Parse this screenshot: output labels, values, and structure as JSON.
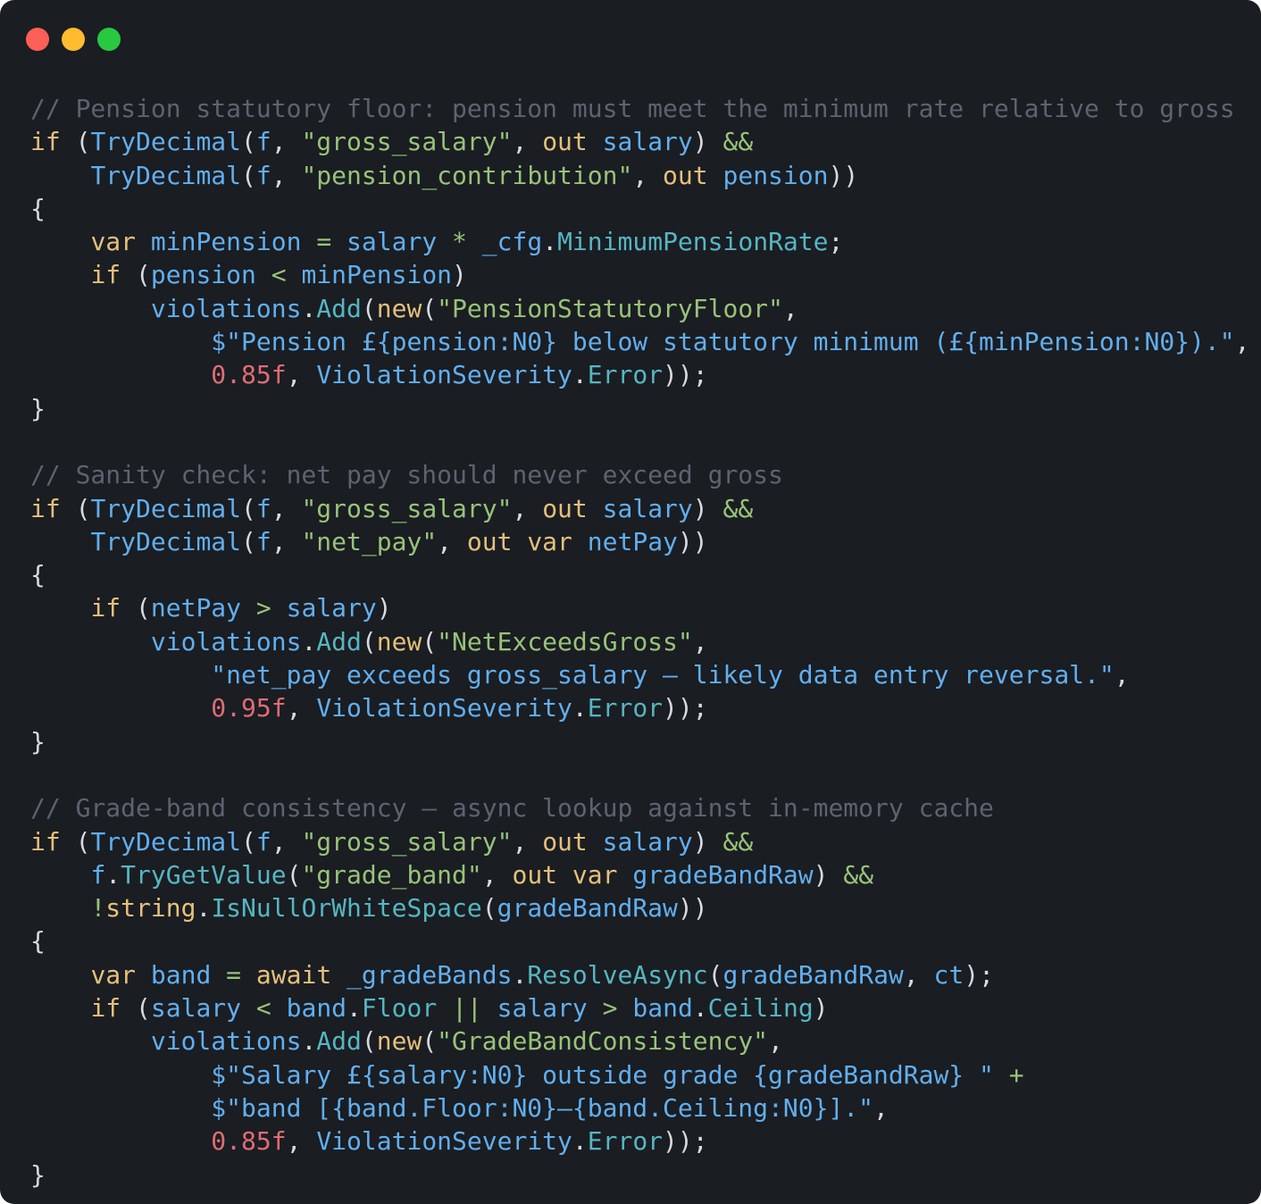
{
  "window": {
    "controls": [
      {
        "name": "close",
        "color": "#ff5f57"
      },
      {
        "name": "minimize",
        "color": "#febc2e"
      },
      {
        "name": "zoom",
        "color": "#28c840"
      }
    ]
  },
  "theme": {
    "background": "#1a1d22",
    "comment": "#5c6370",
    "keyword": "#e5c07b",
    "identifier": "#61afef",
    "property": "#56b6c2",
    "string": "#98c379",
    "number": "#e06c75",
    "operator": "#98c379",
    "punctuation": "#d7dae0"
  },
  "code": {
    "language": "csharp",
    "lines": [
      [
        {
          "t": "comment",
          "v": "// Pension statutory floor: pension must meet the minimum rate relative to gross"
        }
      ],
      [
        {
          "t": "keyword",
          "v": "if"
        },
        {
          "t": "punct",
          "v": " ("
        },
        {
          "t": "ident",
          "v": "TryDecimal"
        },
        {
          "t": "punct",
          "v": "("
        },
        {
          "t": "ident",
          "v": "f"
        },
        {
          "t": "punct",
          "v": ", "
        },
        {
          "t": "string",
          "v": "\"gross_salary\""
        },
        {
          "t": "punct",
          "v": ", "
        },
        {
          "t": "keyword",
          "v": "out"
        },
        {
          "t": "punct",
          "v": " "
        },
        {
          "t": "ident",
          "v": "salary"
        },
        {
          "t": "punct",
          "v": ") "
        },
        {
          "t": "op",
          "v": "&&"
        }
      ],
      [
        {
          "t": "punct",
          "v": "    "
        },
        {
          "t": "ident",
          "v": "TryDecimal"
        },
        {
          "t": "punct",
          "v": "("
        },
        {
          "t": "ident",
          "v": "f"
        },
        {
          "t": "punct",
          "v": ", "
        },
        {
          "t": "string",
          "v": "\"pension_contribution\""
        },
        {
          "t": "punct",
          "v": ", "
        },
        {
          "t": "keyword",
          "v": "out"
        },
        {
          "t": "punct",
          "v": " "
        },
        {
          "t": "ident",
          "v": "pension"
        },
        {
          "t": "punct",
          "v": "))"
        }
      ],
      [
        {
          "t": "punct",
          "v": "{"
        }
      ],
      [
        {
          "t": "punct",
          "v": "    "
        },
        {
          "t": "keyword",
          "v": "var"
        },
        {
          "t": "punct",
          "v": " "
        },
        {
          "t": "ident",
          "v": "minPension"
        },
        {
          "t": "punct",
          "v": " "
        },
        {
          "t": "op",
          "v": "="
        },
        {
          "t": "punct",
          "v": " "
        },
        {
          "t": "ident",
          "v": "salary"
        },
        {
          "t": "punct",
          "v": " "
        },
        {
          "t": "op",
          "v": "*"
        },
        {
          "t": "punct",
          "v": " "
        },
        {
          "t": "ident",
          "v": "_cfg"
        },
        {
          "t": "punct",
          "v": "."
        },
        {
          "t": "prop",
          "v": "MinimumPensionRate"
        },
        {
          "t": "punct",
          "v": ";"
        }
      ],
      [
        {
          "t": "punct",
          "v": "    "
        },
        {
          "t": "keyword",
          "v": "if"
        },
        {
          "t": "punct",
          "v": " ("
        },
        {
          "t": "ident",
          "v": "pension"
        },
        {
          "t": "punct",
          "v": " "
        },
        {
          "t": "op",
          "v": "<"
        },
        {
          "t": "punct",
          "v": " "
        },
        {
          "t": "ident",
          "v": "minPension"
        },
        {
          "t": "punct",
          "v": ")"
        }
      ],
      [
        {
          "t": "punct",
          "v": "        "
        },
        {
          "t": "ident",
          "v": "violations"
        },
        {
          "t": "punct",
          "v": "."
        },
        {
          "t": "prop",
          "v": "Add"
        },
        {
          "t": "punct",
          "v": "("
        },
        {
          "t": "keyword",
          "v": "new"
        },
        {
          "t": "punct",
          "v": "("
        },
        {
          "t": "string",
          "v": "\"PensionStatutoryFloor\""
        },
        {
          "t": "punct",
          "v": ","
        }
      ],
      [
        {
          "t": "punct",
          "v": "            "
        },
        {
          "t": "ident",
          "v": "$\"Pension £{pension:N0} below statutory minimum (£{minPension:N0}).\""
        },
        {
          "t": "punct",
          "v": ","
        }
      ],
      [
        {
          "t": "punct",
          "v": "            "
        },
        {
          "t": "number",
          "v": "0.85f"
        },
        {
          "t": "punct",
          "v": ", "
        },
        {
          "t": "ident",
          "v": "ViolationSeverity"
        },
        {
          "t": "punct",
          "v": "."
        },
        {
          "t": "prop",
          "v": "Error"
        },
        {
          "t": "punct",
          "v": "));"
        }
      ],
      [
        {
          "t": "punct",
          "v": "}"
        }
      ],
      [],
      [
        {
          "t": "comment",
          "v": "// Sanity check: net pay should never exceed gross"
        }
      ],
      [
        {
          "t": "keyword",
          "v": "if"
        },
        {
          "t": "punct",
          "v": " ("
        },
        {
          "t": "ident",
          "v": "TryDecimal"
        },
        {
          "t": "punct",
          "v": "("
        },
        {
          "t": "ident",
          "v": "f"
        },
        {
          "t": "punct",
          "v": ", "
        },
        {
          "t": "string",
          "v": "\"gross_salary\""
        },
        {
          "t": "punct",
          "v": ", "
        },
        {
          "t": "keyword",
          "v": "out"
        },
        {
          "t": "punct",
          "v": " "
        },
        {
          "t": "ident",
          "v": "salary"
        },
        {
          "t": "punct",
          "v": ") "
        },
        {
          "t": "op",
          "v": "&&"
        }
      ],
      [
        {
          "t": "punct",
          "v": "    "
        },
        {
          "t": "ident",
          "v": "TryDecimal"
        },
        {
          "t": "punct",
          "v": "("
        },
        {
          "t": "ident",
          "v": "f"
        },
        {
          "t": "punct",
          "v": ", "
        },
        {
          "t": "string",
          "v": "\"net_pay\""
        },
        {
          "t": "punct",
          "v": ", "
        },
        {
          "t": "keyword",
          "v": "out"
        },
        {
          "t": "punct",
          "v": " "
        },
        {
          "t": "keyword",
          "v": "var"
        },
        {
          "t": "punct",
          "v": " "
        },
        {
          "t": "ident",
          "v": "netPay"
        },
        {
          "t": "punct",
          "v": "))"
        }
      ],
      [
        {
          "t": "punct",
          "v": "{"
        }
      ],
      [
        {
          "t": "punct",
          "v": "    "
        },
        {
          "t": "keyword",
          "v": "if"
        },
        {
          "t": "punct",
          "v": " ("
        },
        {
          "t": "ident",
          "v": "netPay"
        },
        {
          "t": "punct",
          "v": " "
        },
        {
          "t": "op",
          "v": ">"
        },
        {
          "t": "punct",
          "v": " "
        },
        {
          "t": "ident",
          "v": "salary"
        },
        {
          "t": "punct",
          "v": ")"
        }
      ],
      [
        {
          "t": "punct",
          "v": "        "
        },
        {
          "t": "ident",
          "v": "violations"
        },
        {
          "t": "punct",
          "v": "."
        },
        {
          "t": "prop",
          "v": "Add"
        },
        {
          "t": "punct",
          "v": "("
        },
        {
          "t": "keyword",
          "v": "new"
        },
        {
          "t": "punct",
          "v": "("
        },
        {
          "t": "string",
          "v": "\"NetExceedsGross\""
        },
        {
          "t": "punct",
          "v": ","
        }
      ],
      [
        {
          "t": "punct",
          "v": "            "
        },
        {
          "t": "ident",
          "v": "\"net_pay exceeds gross_salary — likely data entry reversal.\""
        },
        {
          "t": "punct",
          "v": ","
        }
      ],
      [
        {
          "t": "punct",
          "v": "            "
        },
        {
          "t": "number",
          "v": "0.95f"
        },
        {
          "t": "punct",
          "v": ", "
        },
        {
          "t": "ident",
          "v": "ViolationSeverity"
        },
        {
          "t": "punct",
          "v": "."
        },
        {
          "t": "prop",
          "v": "Error"
        },
        {
          "t": "punct",
          "v": "));"
        }
      ],
      [
        {
          "t": "punct",
          "v": "}"
        }
      ],
      [],
      [
        {
          "t": "comment",
          "v": "// Grade-band consistency — async lookup against in-memory cache"
        }
      ],
      [
        {
          "t": "keyword",
          "v": "if"
        },
        {
          "t": "punct",
          "v": " ("
        },
        {
          "t": "ident",
          "v": "TryDecimal"
        },
        {
          "t": "punct",
          "v": "("
        },
        {
          "t": "ident",
          "v": "f"
        },
        {
          "t": "punct",
          "v": ", "
        },
        {
          "t": "string",
          "v": "\"gross_salary\""
        },
        {
          "t": "punct",
          "v": ", "
        },
        {
          "t": "keyword",
          "v": "out"
        },
        {
          "t": "punct",
          "v": " "
        },
        {
          "t": "ident",
          "v": "salary"
        },
        {
          "t": "punct",
          "v": ") "
        },
        {
          "t": "op",
          "v": "&&"
        }
      ],
      [
        {
          "t": "punct",
          "v": "    "
        },
        {
          "t": "ident",
          "v": "f"
        },
        {
          "t": "punct",
          "v": "."
        },
        {
          "t": "prop",
          "v": "TryGetValue"
        },
        {
          "t": "punct",
          "v": "("
        },
        {
          "t": "string",
          "v": "\"grade_band\""
        },
        {
          "t": "punct",
          "v": ", "
        },
        {
          "t": "keyword",
          "v": "out"
        },
        {
          "t": "punct",
          "v": " "
        },
        {
          "t": "keyword",
          "v": "var"
        },
        {
          "t": "punct",
          "v": " "
        },
        {
          "t": "ident",
          "v": "gradeBandRaw"
        },
        {
          "t": "punct",
          "v": ") "
        },
        {
          "t": "op",
          "v": "&&"
        }
      ],
      [
        {
          "t": "punct",
          "v": "    "
        },
        {
          "t": "op",
          "v": "!"
        },
        {
          "t": "keyword",
          "v": "string"
        },
        {
          "t": "punct",
          "v": "."
        },
        {
          "t": "prop",
          "v": "IsNullOrWhiteSpace"
        },
        {
          "t": "punct",
          "v": "("
        },
        {
          "t": "ident",
          "v": "gradeBandRaw"
        },
        {
          "t": "punct",
          "v": "))"
        }
      ],
      [
        {
          "t": "punct",
          "v": "{"
        }
      ],
      [
        {
          "t": "punct",
          "v": "    "
        },
        {
          "t": "keyword",
          "v": "var"
        },
        {
          "t": "punct",
          "v": " "
        },
        {
          "t": "ident",
          "v": "band"
        },
        {
          "t": "punct",
          "v": " "
        },
        {
          "t": "op",
          "v": "="
        },
        {
          "t": "punct",
          "v": " "
        },
        {
          "t": "keyword",
          "v": "await"
        },
        {
          "t": "punct",
          "v": " "
        },
        {
          "t": "ident",
          "v": "_gradeBands"
        },
        {
          "t": "punct",
          "v": "."
        },
        {
          "t": "prop",
          "v": "ResolveAsync"
        },
        {
          "t": "punct",
          "v": "("
        },
        {
          "t": "ident",
          "v": "gradeBandRaw"
        },
        {
          "t": "punct",
          "v": ", "
        },
        {
          "t": "ident",
          "v": "ct"
        },
        {
          "t": "punct",
          "v": ");"
        }
      ],
      [
        {
          "t": "punct",
          "v": "    "
        },
        {
          "t": "keyword",
          "v": "if"
        },
        {
          "t": "punct",
          "v": " ("
        },
        {
          "t": "ident",
          "v": "salary"
        },
        {
          "t": "punct",
          "v": " "
        },
        {
          "t": "op",
          "v": "<"
        },
        {
          "t": "punct",
          "v": " "
        },
        {
          "t": "ident",
          "v": "band"
        },
        {
          "t": "punct",
          "v": "."
        },
        {
          "t": "prop",
          "v": "Floor"
        },
        {
          "t": "punct",
          "v": " "
        },
        {
          "t": "op",
          "v": "||"
        },
        {
          "t": "punct",
          "v": " "
        },
        {
          "t": "ident",
          "v": "salary"
        },
        {
          "t": "punct",
          "v": " "
        },
        {
          "t": "op",
          "v": ">"
        },
        {
          "t": "punct",
          "v": " "
        },
        {
          "t": "ident",
          "v": "band"
        },
        {
          "t": "punct",
          "v": "."
        },
        {
          "t": "prop",
          "v": "Ceiling"
        },
        {
          "t": "punct",
          "v": ")"
        }
      ],
      [
        {
          "t": "punct",
          "v": "        "
        },
        {
          "t": "ident",
          "v": "violations"
        },
        {
          "t": "punct",
          "v": "."
        },
        {
          "t": "prop",
          "v": "Add"
        },
        {
          "t": "punct",
          "v": "("
        },
        {
          "t": "keyword",
          "v": "new"
        },
        {
          "t": "punct",
          "v": "("
        },
        {
          "t": "string",
          "v": "\"GradeBandConsistency\""
        },
        {
          "t": "punct",
          "v": ","
        }
      ],
      [
        {
          "t": "punct",
          "v": "            "
        },
        {
          "t": "ident",
          "v": "$\"Salary £{salary:N0} outside grade {gradeBandRaw} \""
        },
        {
          "t": "punct",
          "v": " "
        },
        {
          "t": "op",
          "v": "+"
        }
      ],
      [
        {
          "t": "punct",
          "v": "            "
        },
        {
          "t": "ident",
          "v": "$\"band [{band.Floor:N0}–{band.Ceiling:N0}].\""
        },
        {
          "t": "punct",
          "v": ","
        }
      ],
      [
        {
          "t": "punct",
          "v": "            "
        },
        {
          "t": "number",
          "v": "0.85f"
        },
        {
          "t": "punct",
          "v": ", "
        },
        {
          "t": "ident",
          "v": "ViolationSeverity"
        },
        {
          "t": "punct",
          "v": "."
        },
        {
          "t": "prop",
          "v": "Error"
        },
        {
          "t": "punct",
          "v": "));"
        }
      ],
      [
        {
          "t": "punct",
          "v": "}"
        }
      ]
    ]
  }
}
